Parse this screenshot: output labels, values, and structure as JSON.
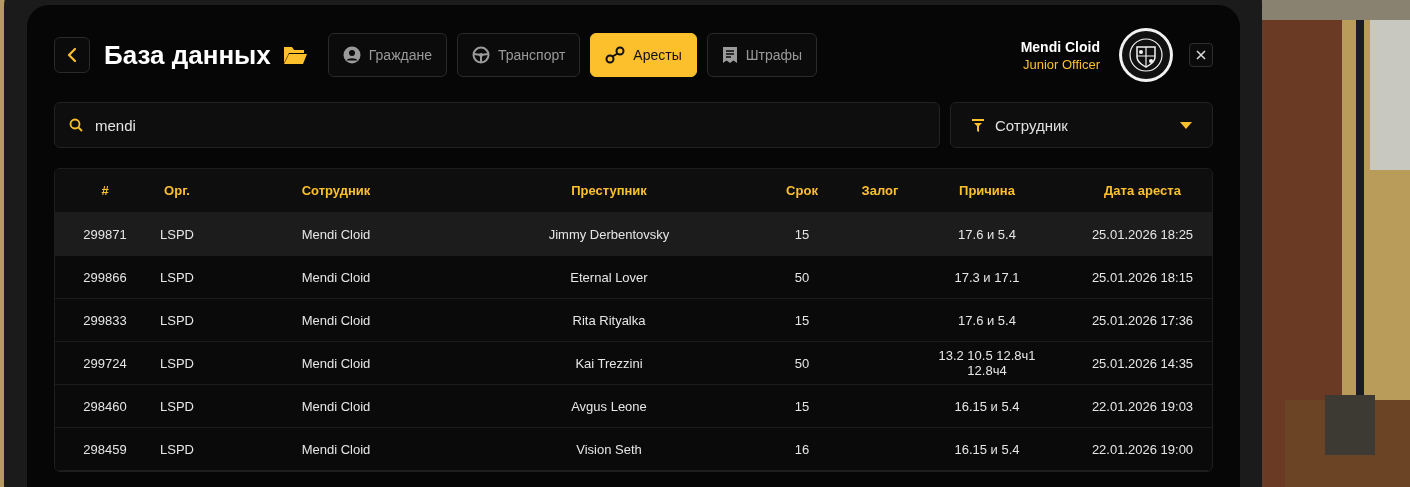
{
  "header": {
    "title": "База данных",
    "tabs": [
      {
        "label": "Граждане",
        "kind": "person",
        "selected": false
      },
      {
        "label": "Транспорт",
        "kind": "wheel",
        "selected": false
      },
      {
        "label": "Аресты",
        "kind": "cuffs",
        "selected": true
      },
      {
        "label": "Штрафы",
        "kind": "receipt",
        "selected": false
      }
    ],
    "user": {
      "name": "Mendi Cloid",
      "rank": "Junior Officer"
    }
  },
  "search": {
    "value": "mendi"
  },
  "filter": {
    "value": "Сотрудник"
  },
  "table": {
    "columns": [
      "#",
      "Орг.",
      "Сотрудник",
      "Преступник",
      "Срок",
      "Залог",
      "Причина",
      "Дата ареста"
    ],
    "rows": [
      {
        "cells": [
          "299871",
          "LSPD",
          "Mendi Cloid",
          "Jimmy Derbentovsky",
          "15",
          "",
          "17.6 и 5.4",
          "25.01.2026 18:25"
        ],
        "selected": true
      },
      {
        "cells": [
          "299866",
          "LSPD",
          "Mendi Cloid",
          "Eternal Lover",
          "50",
          "",
          "17.3 и 17.1",
          "25.01.2026 18:15"
        ],
        "selected": false
      },
      {
        "cells": [
          "299833",
          "LSPD",
          "Mendi Cloid",
          "Rita Rityalka",
          "15",
          "",
          "17.6 и 5.4",
          "25.01.2026 17:36"
        ],
        "selected": false
      },
      {
        "cells": [
          "299724",
          "LSPD",
          "Mendi Cloid",
          "Kai Trezzini",
          "50",
          "",
          "13.2 10.5 12.8ч1 12.8ч4",
          "25.01.2026 14:35"
        ],
        "selected": false
      },
      {
        "cells": [
          "298460",
          "LSPD",
          "Mendi Cloid",
          "Avgus Leone",
          "15",
          "",
          "16.15 и 5.4",
          "22.01.2026 19:03"
        ],
        "selected": false
      },
      {
        "cells": [
          "298459",
          "LSPD",
          "Mendi Cloid",
          "Vision Seth",
          "16",
          "",
          "16.15 и 5.4",
          "22.01.2026 19:00"
        ],
        "selected": false
      }
    ]
  }
}
